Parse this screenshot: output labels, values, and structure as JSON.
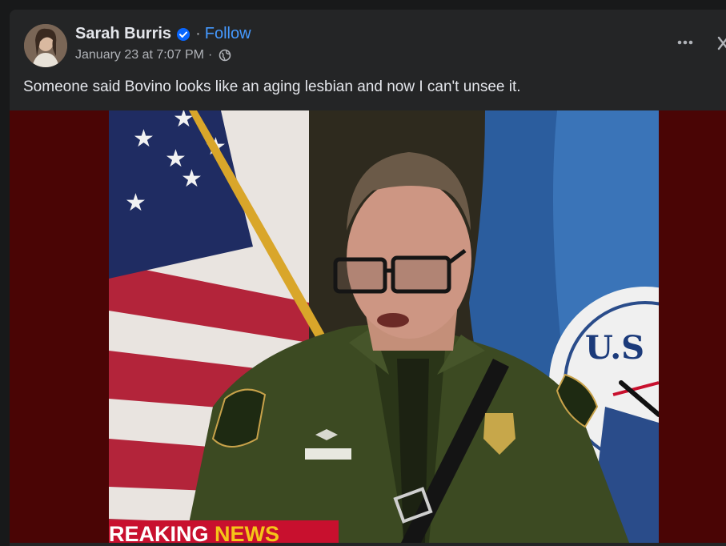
{
  "post": {
    "author": "Sarah Burris",
    "follow_label": "Follow",
    "separator": "·",
    "timestamp": "January 23 at 7:07 PM",
    "meta_separator": "·",
    "privacy_icon": "globe-icon",
    "verified_icon": "verified-badge-icon",
    "caption": "Someone said Bovino looks like an aging lesbian and now I can't unsee it."
  },
  "media": {
    "banner_text": "REAKING NEWS",
    "banner_color": "#c8102e",
    "seal_text": "U.S"
  },
  "colors": {
    "background": "#18191a",
    "card": "#242526",
    "accent": "#4599ff",
    "media_backdrop": "#4a0505"
  }
}
